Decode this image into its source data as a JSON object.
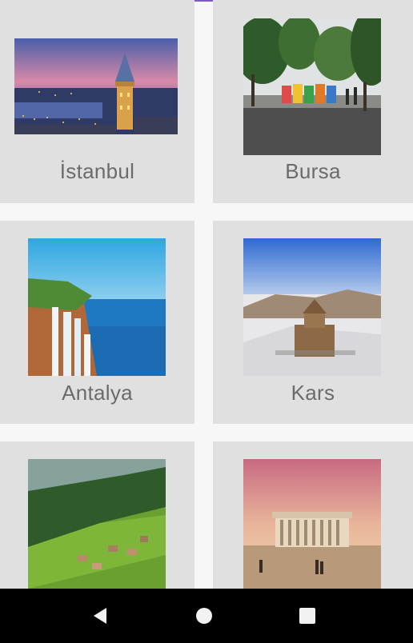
{
  "cities": [
    {
      "name": "İstanbul",
      "image": "galata-tower-photo"
    },
    {
      "name": "Bursa",
      "image": "bursa-square-photo"
    },
    {
      "name": "Antalya",
      "image": "duden-waterfall-photo"
    },
    {
      "name": "Kars",
      "image": "kars-church-photo"
    },
    {
      "name": "",
      "image": "green-highlands-photo"
    },
    {
      "name": "",
      "image": "anitkabir-photo"
    }
  ],
  "navigation": {
    "back": "back-icon",
    "home": "home-icon",
    "recents": "recents-icon"
  },
  "colors": {
    "card": "#e0e0e0",
    "background": "#f7f7f7",
    "label": "#6b6b6b",
    "navbar": "#000000",
    "accent": "#7b5cc4"
  }
}
